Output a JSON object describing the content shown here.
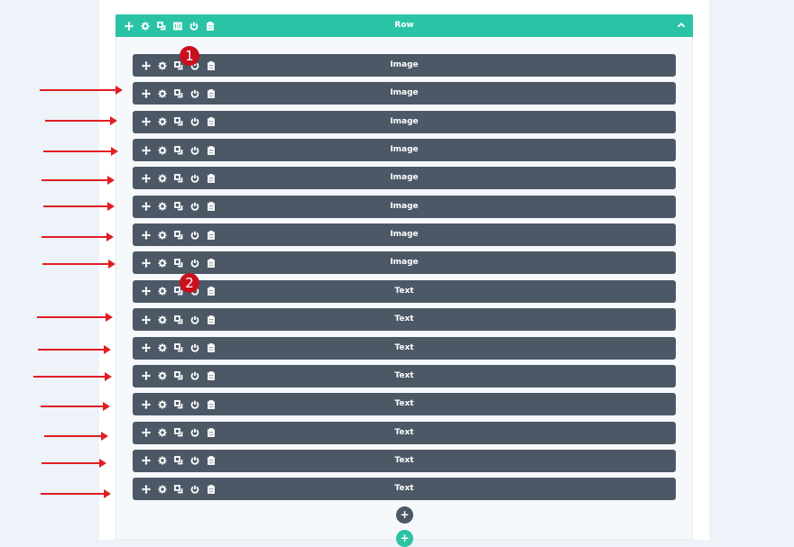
{
  "row": {
    "title": "Row",
    "collapse_icon": "chevron-up-icon",
    "color": "#2bc3a6",
    "icons": [
      "move-icon",
      "gear-icon",
      "duplicate-icon",
      "columns-icon",
      "power-icon",
      "trash-icon"
    ]
  },
  "modules": {
    "color": "#4c5866",
    "icons": [
      "move-icon",
      "gear-icon",
      "duplicate-icon",
      "power-icon",
      "trash-icon"
    ],
    "items": [
      {
        "label": "Image"
      },
      {
        "label": "Image"
      },
      {
        "label": "Image"
      },
      {
        "label": "Image"
      },
      {
        "label": "Image"
      },
      {
        "label": "Image"
      },
      {
        "label": "Image"
      },
      {
        "label": "Image"
      },
      {
        "label": "Text"
      },
      {
        "label": "Text"
      },
      {
        "label": "Text"
      },
      {
        "label": "Text"
      },
      {
        "label": "Text"
      },
      {
        "label": "Text"
      },
      {
        "label": "Text"
      },
      {
        "label": "Text"
      }
    ]
  },
  "annotations": {
    "badge_1": "1",
    "badge_2": "2",
    "arrow_color": "#e01e24",
    "badge_color": "#c8101e"
  },
  "buttons": {
    "add_module": "+",
    "add_row": "+"
  }
}
